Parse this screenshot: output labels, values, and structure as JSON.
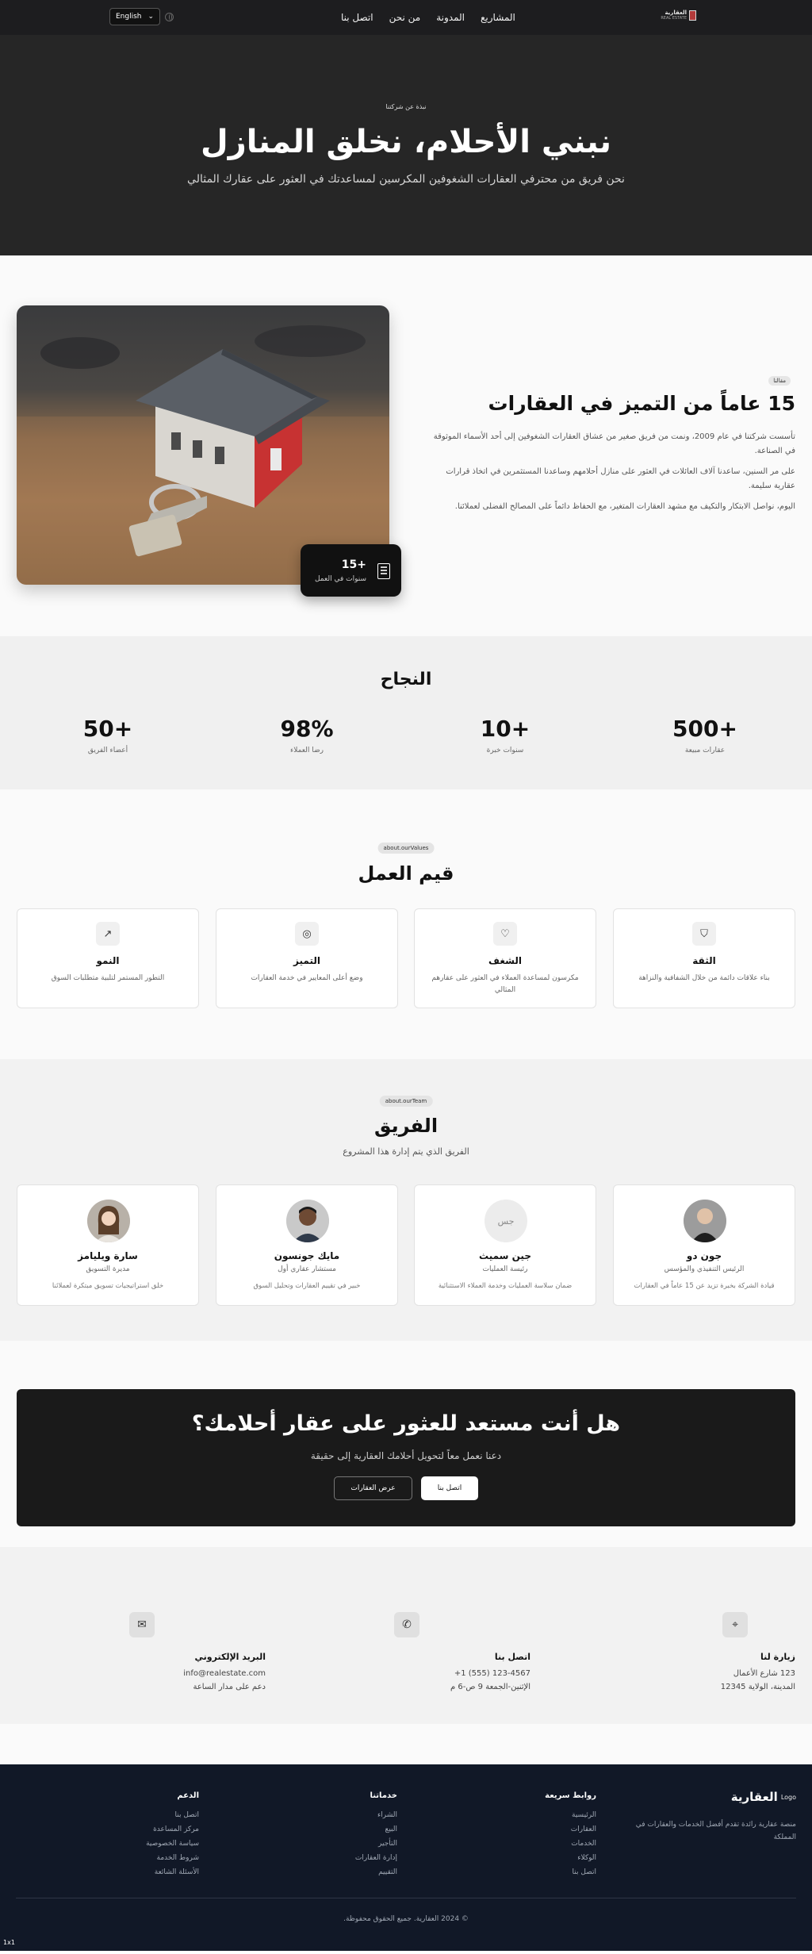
{
  "nav": {
    "logo_title": "العقارية",
    "logo_sub": "REAL ESTATE",
    "links": [
      "المشاريع",
      "المدونة",
      "من نحن",
      "اتصل بنا"
    ],
    "language": "English"
  },
  "hero": {
    "eyebrow": "نبذة عن شركتنا",
    "title": "نبني الأحلام، نخلق المنازل",
    "subtitle": "نحن فريق من محترفي العقارات الشغوفين المكرسين لمساعدتك في العثور على عقارك المثالي"
  },
  "about": {
    "tag": "مقالنا",
    "title": "15 عاماً من التميز في العقارات",
    "paragraphs": [
      "تأسست شركتنا في عام 2009، ونمت من فريق صغير من عشاق العقارات الشغوفين إلى أحد الأسماء الموثوقة في الصناعة.",
      "على مر السنين، ساعدنا آلاف العائلات في العثور على منازل أحلامهم وساعدنا المستثمرين في اتخاذ قرارات عقارية سليمة.",
      "اليوم، نواصل الابتكار والتكيف مع مشهد العقارات المتغير، مع الحفاظ دائماً على المصالح الفضلى لعملائنا."
    ],
    "badge_value": "+15",
    "badge_label": "سنوات في العمل"
  },
  "success": {
    "title": "النجاح",
    "stats": [
      {
        "value": "+500",
        "label": "عقارات مبيعة"
      },
      {
        "value": "+10",
        "label": "سنوات خبرة"
      },
      {
        "value": "98%",
        "label": "رضا العملاء"
      },
      {
        "value": "+50",
        "label": "أعضاء الفريق"
      }
    ]
  },
  "values": {
    "pill": "about.ourValues",
    "title": "قيم العمل",
    "cards": [
      {
        "icon": "shield-icon",
        "title": "الثقة",
        "desc": "بناء علاقات دائمة من خلال الشفافية والنزاهة"
      },
      {
        "icon": "heart-icon",
        "title": "الشغف",
        "desc": "مكرسون لمساعدة العملاء في العثور على عقارهم المثالي"
      },
      {
        "icon": "target-icon",
        "title": "التميز",
        "desc": "وضع أعلى المعايير في خدمة العقارات"
      },
      {
        "icon": "trending-up-icon",
        "title": "النمو",
        "desc": "التطور المستمر لتلبية متطلبات السوق"
      }
    ]
  },
  "team": {
    "pill": "about.ourTeam",
    "title": "الفريق",
    "subtitle": "الفريق الذي يتم إدارة هذا المشروع",
    "members": [
      {
        "name": "جون دو",
        "role": "الرئيس التنفيذي والمؤسس",
        "desc": "قيادة الشركة بخبرة تزيد عن 15 عاماً في العقارات",
        "avatar": "photo",
        "initials": ""
      },
      {
        "name": "جين سميث",
        "role": "رئيسة العمليات",
        "desc": "ضمان سلاسة العمليات وخدمة العملاء الاستثنائية",
        "avatar": "initials",
        "initials": "جس"
      },
      {
        "name": "مايك جونسون",
        "role": "مستشار عقاري أول",
        "desc": "خبير في تقييم العقارات وتحليل السوق",
        "avatar": "photo",
        "initials": ""
      },
      {
        "name": "سارة ويليامز",
        "role": "مديرة التسويق",
        "desc": "خلق استراتيجيات تسويق مبتكرة لعملائنا",
        "avatar": "photo",
        "initials": ""
      }
    ]
  },
  "cta": {
    "title": "هل أنت مستعد للعثور على عقار أحلامك؟",
    "subtitle": "دعنا نعمل معاً لتحويل أحلامك العقارية إلى حقيقة",
    "primary": "اتصل بنا",
    "secondary": "عرض العقارات"
  },
  "contact": {
    "items": [
      {
        "icon": "map-pin-icon",
        "title": "زيارة لنا",
        "lines": [
          "123 شارع الأعمال",
          "المدينة، الولاية 12345"
        ]
      },
      {
        "icon": "phone-icon",
        "title": "اتصل بنا",
        "lines": [
          "+1 (555) 123-4567",
          "الإثنين-الجمعة 9 ص-6 م"
        ]
      },
      {
        "icon": "mail-icon",
        "title": "البريد الإلكتروني",
        "lines": [
          "info@realestate.com",
          "دعم على مدار الساعة"
        ]
      }
    ]
  },
  "footer": {
    "logo_alt": "Logo",
    "title": "العقارية",
    "desc": "منصة عقارية رائدة تقدم أفضل الخدمات والعقارات في المملكة",
    "columns": [
      {
        "title": "روابط سريعة",
        "links": [
          "الرئيسية",
          "العقارات",
          "الخدمات",
          "الوكلاء",
          "اتصل بنا"
        ]
      },
      {
        "title": "خدماتنا",
        "links": [
          "الشراء",
          "البيع",
          "التأجير",
          "إدارة العقارات",
          "التقييم"
        ]
      },
      {
        "title": "الدعم",
        "links": [
          "اتصل بنا",
          "مركز المساعدة",
          "سياسة الخصوصية",
          "شروط الخدمة",
          "الأسئلة الشائعة"
        ]
      }
    ],
    "copyright": "© 2024 العقارية. جميع الحقوق محفوظة.",
    "corner": "1x1"
  }
}
